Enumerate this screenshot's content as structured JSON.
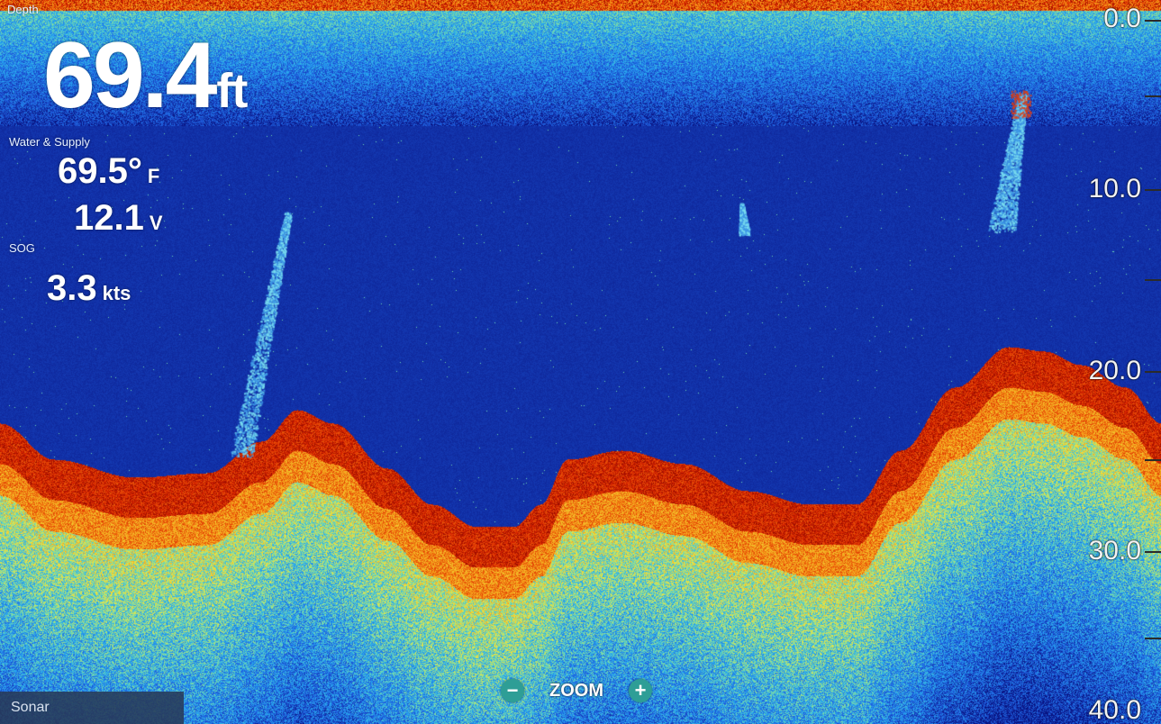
{
  "window": {
    "app_tab": "Sonar"
  },
  "depth": {
    "label": "Depth",
    "value": "69.4",
    "unit": "ft"
  },
  "water_supply": {
    "label": "Water & Supply",
    "temperature": {
      "value": "69.5°",
      "unit": "F"
    },
    "voltage": {
      "value": "12.1",
      "unit": "V"
    }
  },
  "sog": {
    "label": "SOG",
    "value": "3.3",
    "unit": "kts"
  },
  "depth_scale": {
    "labels": [
      "0.0",
      "10.0",
      "20.0",
      "30.0",
      "40.0"
    ]
  },
  "zoom": {
    "label": "ZOOM",
    "minus_icon": "minus-icon",
    "plus_icon": "plus-icon"
  },
  "colors": {
    "water": "#06107a",
    "bottom_return": "#c71d00",
    "sediment": "#f2e13a",
    "noise": "#2aa6e8",
    "zoom_button": "#2e9e96"
  }
}
